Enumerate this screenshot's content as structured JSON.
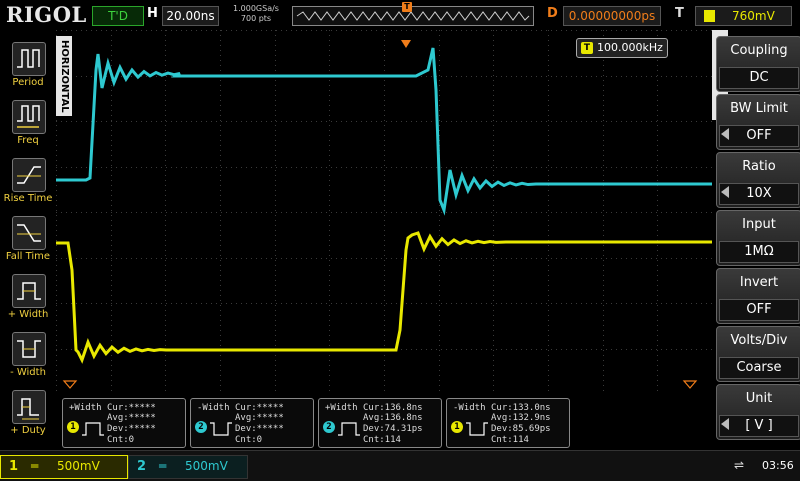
{
  "brand": "RIGOL",
  "top": {
    "run_state": "T'D",
    "h_label": "H",
    "timebase": "20.00ns",
    "sample_rate": "1.000GSa/s",
    "memory_depth": "700 pts",
    "trigger_pos_marker": "T",
    "d_label": "D",
    "delay": "0.00000000ps",
    "t_label": "T",
    "trigger_level": "760mV"
  },
  "left_menu": [
    {
      "label": "Period"
    },
    {
      "label": "Freq"
    },
    {
      "label": "Rise Time"
    },
    {
      "label": "Fall Time"
    },
    {
      "label": "+ Width"
    },
    {
      "label": "- Width"
    },
    {
      "label": "+ Duty"
    }
  ],
  "horizontal_label": "HORIZONTAL",
  "frequency_counter": {
    "icon": "T",
    "value": "100.000kHz"
  },
  "right_menu": {
    "channel": "CH1",
    "items": [
      {
        "title": "Coupling",
        "value": "DC"
      },
      {
        "title": "BW Limit",
        "value": "OFF"
      },
      {
        "title": "Ratio",
        "value": "10X"
      },
      {
        "title": "Input",
        "value": "1MΩ"
      },
      {
        "title": "Invert",
        "value": "OFF"
      },
      {
        "title": "Volts/Div",
        "value": "Coarse"
      },
      {
        "title": "Unit",
        "value": "[ V ]"
      }
    ]
  },
  "measurements": [
    {
      "title": "+Width",
      "channel": "1",
      "cur": "Cur:*****",
      "avg": "Avg:*****",
      "dev": "Dev:*****",
      "cnt": "Cnt:0"
    },
    {
      "title": "-Width",
      "channel": "2",
      "cur": "Cur:*****",
      "avg": "Avg:*****",
      "dev": "Dev:*****",
      "cnt": "Cnt:0"
    },
    {
      "title": "+Width",
      "channel": "2",
      "cur": "Cur:136.8ns",
      "avg": "Avg:136.8ns",
      "dev": "Dev:74.31ps",
      "cnt": "Cnt:114"
    },
    {
      "title": "-Width",
      "channel": "1",
      "cur": "Cur:133.0ns",
      "avg": "Avg:132.9ns",
      "dev": "Dev:85.69ps",
      "cnt": "Cnt:114"
    }
  ],
  "bottom": {
    "ch1": {
      "num": "1",
      "scale": "500mV"
    },
    "ch2": {
      "num": "2",
      "scale": "500mV"
    },
    "time": "03:56"
  },
  "colors": {
    "ch1": "#e8e800",
    "ch2": "#2ec9d0",
    "trigger": "#f07d1a"
  }
}
